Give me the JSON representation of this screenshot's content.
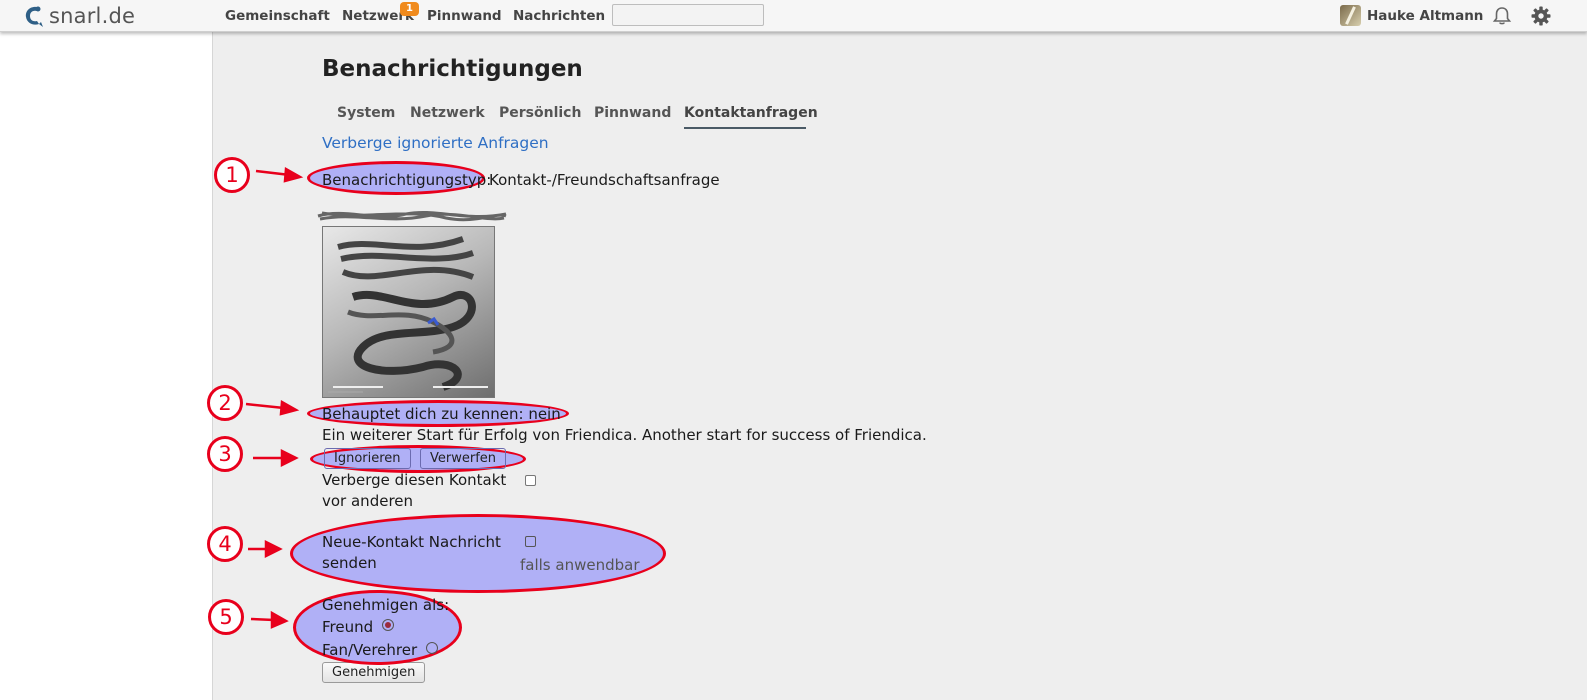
{
  "brand": {
    "name": "snarl.de"
  },
  "nav": {
    "items": [
      {
        "label": "Gemeinschaft"
      },
      {
        "label": "Netzwerk"
      },
      {
        "label": "Pinnwand"
      },
      {
        "label": "Nachrichten"
      }
    ],
    "network_badge": "1",
    "search_placeholder": ""
  },
  "user": {
    "name": "Hauke Altmann"
  },
  "page": {
    "title": "Benachrichtigungen",
    "tabs": [
      {
        "label": "System"
      },
      {
        "label": "Netzwerk"
      },
      {
        "label": "Persönlich"
      },
      {
        "label": "Pinnwand"
      },
      {
        "label": "Kontaktanfragen",
        "active": true
      }
    ],
    "hide_ignored_link": "Verberge ignorierte Anfragen"
  },
  "request": {
    "type_label": "Benachrichtigungstyp:",
    "type_value": "Kontakt-/Freundschaftsanfrage",
    "knows_you": "Behauptet dich zu kennen: nein",
    "message": "Ein weiterer Start für Erfolg von Friendica. Another start for success of Friendica.",
    "ignore_button": "Ignorieren",
    "discard_button": "Verwerfen",
    "hide_contact_line1": "Verberge diesen Kontakt",
    "hide_contact_line2": "vor anderen",
    "new_contact_line1": "Neue-Kontakt Nachricht",
    "new_contact_line2": "senden",
    "new_contact_hint": "falls anwendbar",
    "approve_as": "Genehmigen als:",
    "option_friend": "Freund",
    "option_fan": "Fan/Verehrer",
    "approve_button": "Genehmigen"
  },
  "annotations": [
    "1",
    "2",
    "3",
    "4",
    "5"
  ],
  "colors": {
    "accent_link": "#2f6fc4",
    "annotation_red": "#e8001c",
    "annotation_fill": "#6464ff",
    "badge_orange": "#f08a1c"
  },
  "icons": {
    "brand": "snarl-logo-icon",
    "bell": "bell-icon",
    "gear": "gear-icon"
  }
}
